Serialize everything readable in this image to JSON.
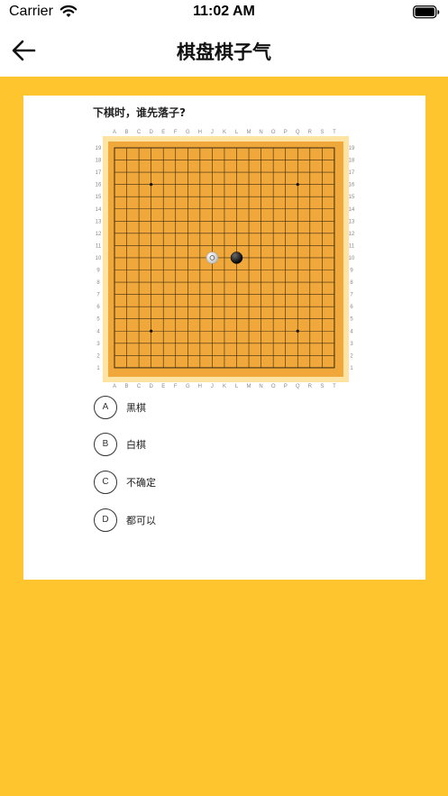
{
  "status_bar": {
    "carrier": "Carrier",
    "time": "11:02 AM"
  },
  "header": {
    "title": "棋盘棋子气",
    "back_icon": "arrow-left-icon"
  },
  "quiz": {
    "question": "下棋时，谁先落子?",
    "options": [
      {
        "letter": "A",
        "text": "黑棋"
      },
      {
        "letter": "B",
        "text": "白棋"
      },
      {
        "letter": "C",
        "text": "不确定"
      },
      {
        "letter": "D",
        "text": "都可以"
      }
    ]
  },
  "board": {
    "size": 19,
    "columns": [
      "A",
      "B",
      "C",
      "D",
      "E",
      "F",
      "G",
      "H",
      "J",
      "K",
      "L",
      "M",
      "N",
      "O",
      "P",
      "Q",
      "R",
      "S",
      "T"
    ],
    "rows": [
      "19",
      "18",
      "17",
      "16",
      "15",
      "14",
      "13",
      "12",
      "11",
      "10",
      "9",
      "8",
      "7",
      "6",
      "5",
      "4",
      "3",
      "2",
      "1"
    ],
    "star_points": [
      "D16",
      "Q16",
      "D4",
      "Q4"
    ],
    "stones": [
      {
        "color": "white",
        "point": "J10",
        "marked": true
      },
      {
        "color": "black",
        "point": "L10"
      }
    ],
    "colors": {
      "board": "#F0A83A",
      "frame": "#FFE3A3",
      "line": "#3a2a10"
    }
  },
  "colors": {
    "background": "#FFC52E",
    "card": "#FFFFFF"
  }
}
